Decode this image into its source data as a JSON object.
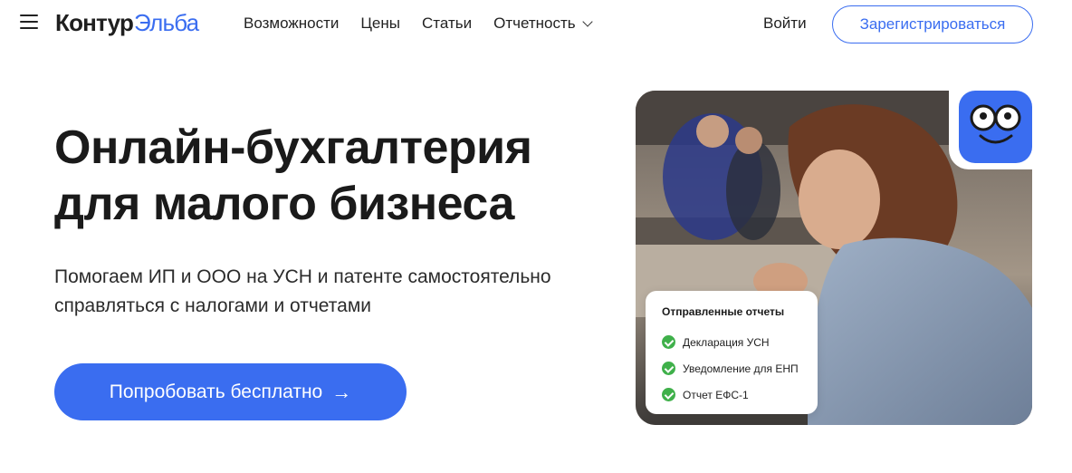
{
  "header": {
    "logo_part1": "Контур",
    "logo_part2": "Эльба",
    "nav": [
      "Возможности",
      "Цены",
      "Статьи",
      "Отчетность"
    ],
    "login": "Войти",
    "register": "Зарегистрироваться"
  },
  "hero": {
    "title_line1": "Онлайн-бухгалтерия",
    "title_line2": "для малого бизнеса",
    "subtitle_line1": "Помогаем ИП и ООО на УСН и патенте самостоятельно",
    "subtitle_line2": "справляться с налогами и отчетами",
    "cta": "Попробовать бесплатно",
    "cta_arrow": "→"
  },
  "reports_card": {
    "title": "Отправленные отчеты",
    "items": [
      "Декларация УСН",
      "Уведомление для ЕНП",
      "Отчет ЕФС-1"
    ]
  },
  "colors": {
    "accent": "#3a6df0",
    "check": "#3fb04a"
  },
  "icons": [
    "menu-icon",
    "chevron-down-icon",
    "arrow-right-icon",
    "mascot-face-icon",
    "check-circle-icon"
  ]
}
